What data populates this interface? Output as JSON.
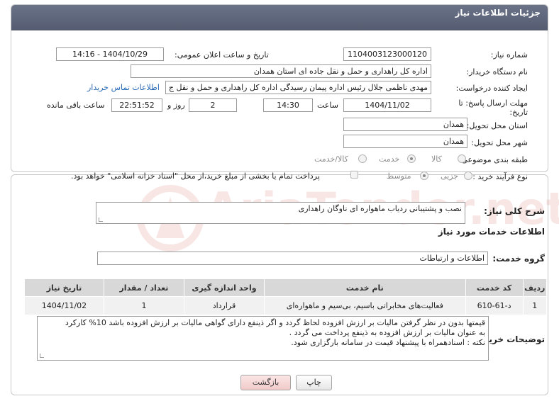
{
  "header": {
    "title": "جزئیات اطلاعات نیاز"
  },
  "fields": {
    "need_number_label": "شماره نیاز:",
    "need_number": "1104003123000120",
    "announce_label": "تاریخ و ساعت اعلان عمومی:",
    "announce_value": "1404/10/29 - 14:16",
    "buyer_org_label": "نام دستگاه خریدار:",
    "buyer_org": "اداره کل راهداری و حمل و نقل جاده ای استان همدان",
    "requester_label": "ایجاد کننده درخواست:",
    "requester": "مهدی ناظمی جلال رئیس اداره پیمان رسیدگی اداره کل راهداری و حمل و نقل ج",
    "contact_link": "اطلاعات تماس خریدار",
    "deadline_label_1": "مهلت ارسال پاسخ: تا",
    "deadline_label_2": "تاریخ:",
    "deadline_date": "1404/11/02",
    "time_label": "ساعت",
    "deadline_time": "14:30",
    "days_value": "2",
    "days_label": "روز و",
    "remaining_time": "22:51:52",
    "remaining_label": "ساعت باقی مانده",
    "province_label": "استان محل تحویل:",
    "province": "همدان",
    "city_label": "شهر محل تحویل:",
    "city": "همدان",
    "category_label": "طبقه بندی موضوعی:",
    "category_options": [
      "کالا",
      "خدمت",
      "کالا/خدمت"
    ],
    "category_selected": "خدمت",
    "process_label": "نوع فرآیند خرید :",
    "process_options": [
      "جزیی",
      "متوسط"
    ],
    "process_selected": "متوسط",
    "treasury_note": "پرداخت تمام یا بخشی از مبلغ خرید،از محل \"اسناد خزانه اسلامی\" خواهد بود."
  },
  "summary": {
    "label": "شرح کلی نیاز:",
    "value": "نصب و پشتیبانی ردیاب ماهواره ای ناوگان راهداری"
  },
  "services": {
    "section_title": "اطلاعات خدمات مورد نیاز",
    "group_label": "گروه خدمت:",
    "group_value": "اطلاعات و ارتباطات",
    "columns": [
      "ردیف",
      "کد خدمت",
      "نام خدمت",
      "واحد اندازه گیری",
      "تعداد / مقدار",
      "تاریخ نیاز"
    ],
    "rows": [
      [
        "1",
        "د-61-610",
        "فعالیت‌های مخابراتی باسیم، بی‌سیم و ماهواره‌ای",
        "قرارداد",
        "1",
        "1404/11/02"
      ]
    ]
  },
  "notes": {
    "label": "توضیحات خریدار:",
    "lines": [
      "قیمتها بدون در نظر گرفتن مالیات بر ارزش افزوده لحاظ گردد و اگر ذینفع دارای گواهی مالیات بر ارزش افزوده باشد 10% کارکرد",
      "به عنوان مالیات بر ارزش افزوده به ذینفع پرداخت می گردد .",
      "نکته : اسنادهمراه با پیشنهاد قیمت در سامانه بارگزاری شود."
    ]
  },
  "buttons": {
    "print": "چاپ",
    "back": "بازگشت"
  },
  "watermark": {
    "text": "AriaTender.net",
    "color": "#c0392b"
  },
  "colors": {
    "header_bg": "#5f6679",
    "link": "#2a6ab5",
    "back_button": "#f2c9c9"
  }
}
